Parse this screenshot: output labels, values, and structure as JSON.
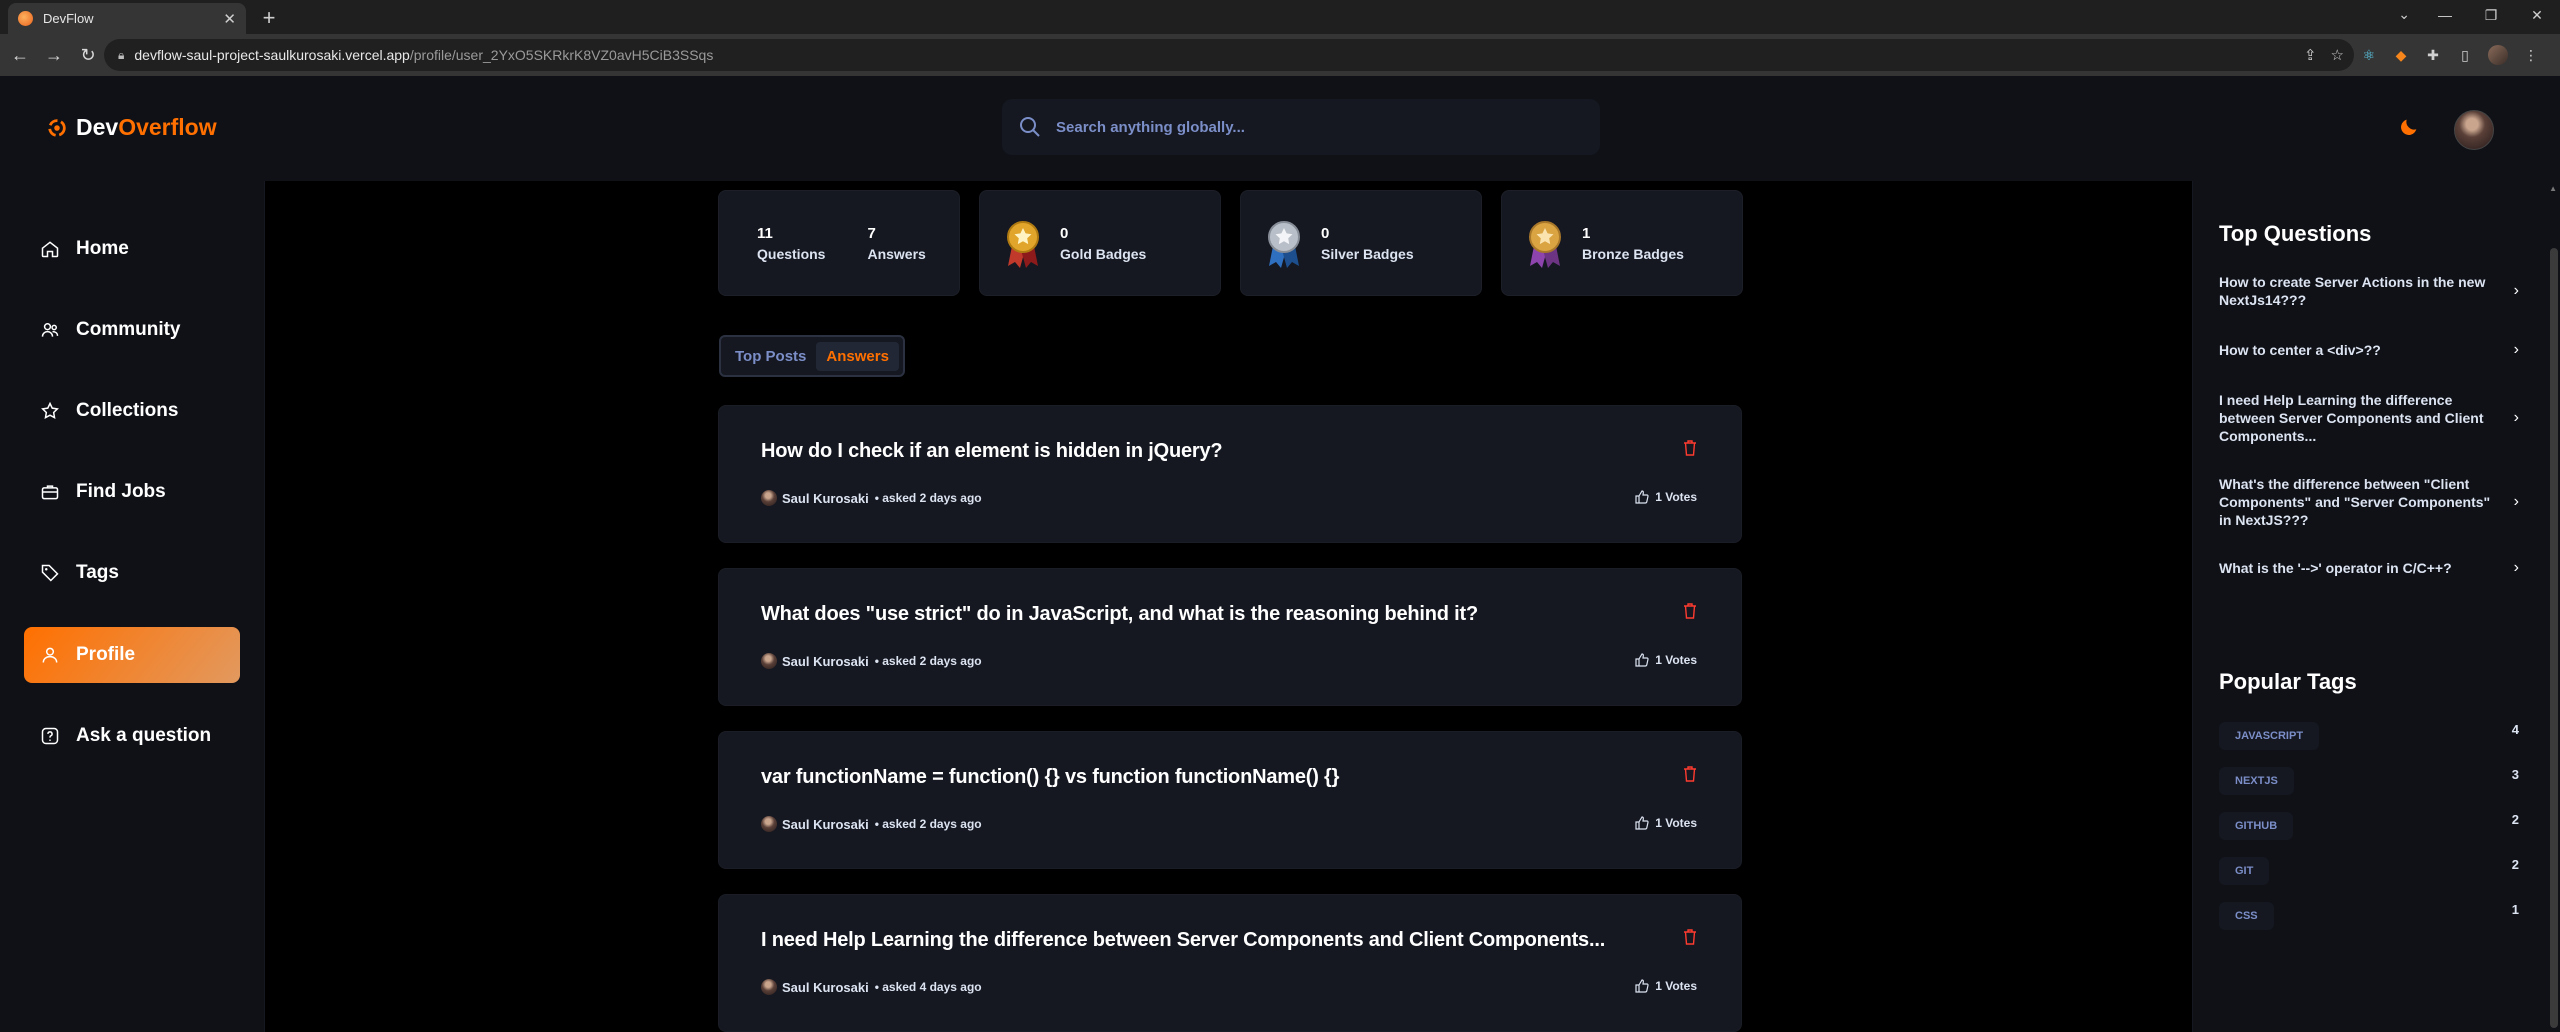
{
  "browser": {
    "tab_title": "DevFlow",
    "url_host": "devflow-saul-project-saulkurosaki.vercel.app",
    "url_path": "/profile/user_2YxO5SKRkrK8VZ0avH5CiB3SSqs"
  },
  "header": {
    "logo_dev": "Dev",
    "logo_overflow": "Overflow",
    "search_placeholder": "Search anything globally..."
  },
  "sidebar": {
    "items": [
      {
        "label": "Home",
        "icon": "home-icon"
      },
      {
        "label": "Community",
        "icon": "users-icon"
      },
      {
        "label": "Collections",
        "icon": "star-icon"
      },
      {
        "label": "Find Jobs",
        "icon": "suitcase-icon"
      },
      {
        "label": "Tags",
        "icon": "tag-icon"
      },
      {
        "label": "Profile",
        "icon": "user-icon",
        "active": true
      },
      {
        "label": "Ask a question",
        "icon": "question-icon"
      }
    ]
  },
  "stats": {
    "questions_count": "11",
    "questions_label": "Questions",
    "answers_count": "7",
    "answers_label": "Answers",
    "gold_count": "0",
    "gold_label": "Gold Badges",
    "silver_count": "0",
    "silver_label": "Silver Badges",
    "bronze_count": "1",
    "bronze_label": "Bronze Badges"
  },
  "tabs": {
    "top_posts": "Top Posts",
    "answers": "Answers",
    "active": "answers"
  },
  "posts": [
    {
      "title": "How do I check if an element is hidden in jQuery?",
      "author": "Saul Kurosaki",
      "when": "• asked 2 days ago",
      "votes": "1 Votes"
    },
    {
      "title": "What does \"use strict\" do in JavaScript, and what is the reasoning behind it?",
      "author": "Saul Kurosaki",
      "when": "• asked 2 days ago",
      "votes": "1 Votes"
    },
    {
      "title": "var functionName = function() {} vs function functionName() {}",
      "author": "Saul Kurosaki",
      "when": "• asked 2 days ago",
      "votes": "1 Votes"
    },
    {
      "title": "I need Help Learning the difference between Server Components and Client Components...",
      "author": "Saul Kurosaki",
      "when": "• asked 4 days ago",
      "votes": "1 Votes"
    }
  ],
  "right": {
    "top_questions_title": "Top Questions",
    "top_questions": [
      "How to create Server Actions in the new NextJs14???",
      "How to center a <div>??",
      "I need Help Learning the difference between Server Components and Client Components...",
      "What's the difference between \"Client Components\" and \"Server Components\" in NextJS???",
      "What is the '-->' operator in C/C++?"
    ],
    "popular_tags_title": "Popular Tags",
    "tags": [
      {
        "name": "JAVASCRIPT",
        "count": "4"
      },
      {
        "name": "NEXTJS",
        "count": "3"
      },
      {
        "name": "GITHUB",
        "count": "2"
      },
      {
        "name": "GIT",
        "count": "2"
      },
      {
        "name": "CSS",
        "count": "1"
      }
    ]
  },
  "colors": {
    "accent": "#ff7000",
    "card_bg": "#151821",
    "panel_bg": "#0f1117",
    "link_blue": "#7b8ec8"
  }
}
